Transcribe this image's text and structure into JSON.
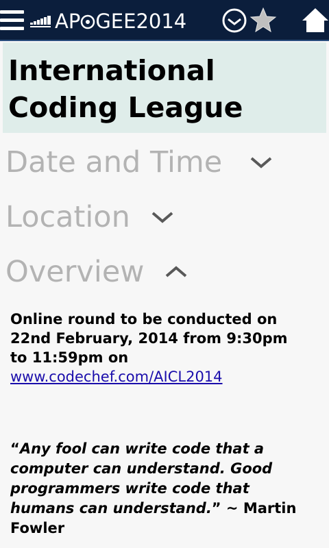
{
  "header": {
    "logo_text": "APOGEE2014",
    "logo_left": "AP",
    "logo_right": "GEE2014",
    "icons": [
      "menu-icon",
      "logo-icon",
      "timer-icon",
      "star-icon",
      "home-icon"
    ],
    "colors": {
      "bar_background": "#0b1e3c",
      "icon_color": "#ffffff",
      "star_color": "#bfbfbf"
    }
  },
  "event": {
    "title": "International Coding League",
    "title_panel_color": "#dfedea"
  },
  "sections": [
    {
      "label": "Date and Time",
      "expanded": false
    },
    {
      "label": "Location",
      "expanded": false
    },
    {
      "label": "Overview",
      "expanded": true
    }
  ],
  "overview": {
    "text_before_link": "Online round to be conducted on 22nd February, 2014 from 9:30pm to 11:59pm on ",
    "link_text": "www.codechef.com/AICL2014",
    "quote_open": "“",
    "quote_text": "Any fool can write code that a computer can understand. Good programmers write code that humans can understand.",
    "quote_close": "”",
    "quote_attribution": " ~ Martin Fowler"
  }
}
